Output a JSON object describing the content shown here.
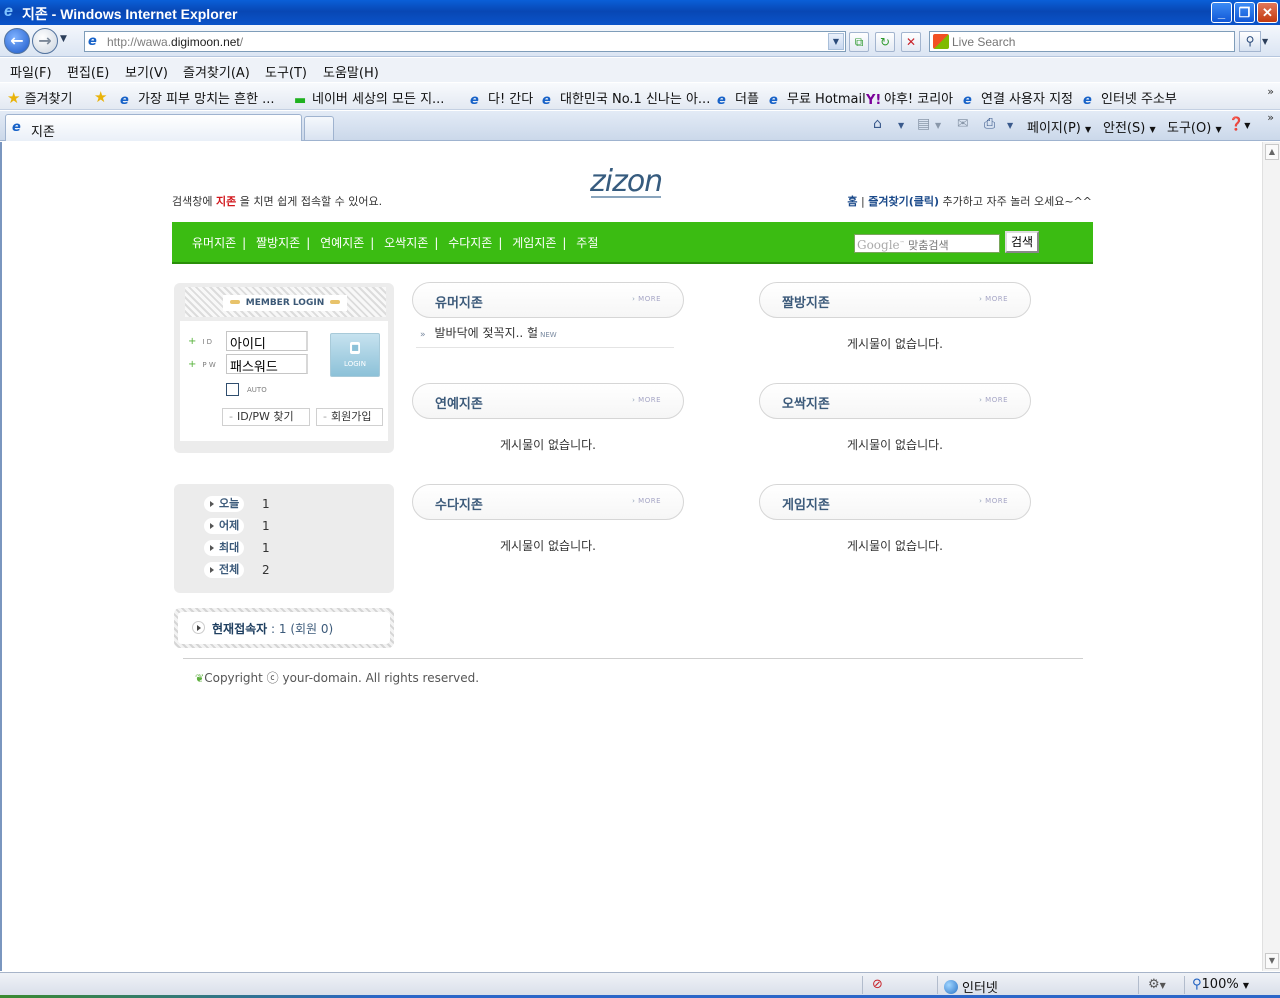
{
  "window": {
    "title": "지존 - Windows Internet Explorer"
  },
  "address": {
    "url_prefix": "http://wawa.",
    "url_domain": "digimoon.net",
    "url_suffix": "/"
  },
  "search": {
    "placeholder": "Live Search"
  },
  "menu": {
    "items": [
      "파일(F)",
      "편집(E)",
      "보기(V)",
      "즐겨찾기(A)",
      "도구(T)",
      "도움말(H)"
    ]
  },
  "favorites": {
    "label": "즐겨찾기",
    "links": [
      "가장 피부 망치는 흔한 ...",
      "네이버 세상의 모든 지...",
      "다! 간다",
      "대한민국 No.1 신나는 아...",
      "더플",
      "무료 Hotmail",
      "야후! 코리아",
      "연결 사용자 지정",
      "인터넷 주소부"
    ]
  },
  "tabs": [
    {
      "label": "지존"
    }
  ],
  "commandbar": {
    "page": "페이지(P)",
    "safety": "안전(S)",
    "tools": "도구(O)"
  },
  "site": {
    "logo": "zizon",
    "tagline_pre": "검색창에 ",
    "tagline_red": "지존",
    "tagline_post": " 을 치면 쉽게 접속할 수 있어요.",
    "toplinks_home": "홈",
    "toplinks_sep": " | ",
    "toplinks_fav": "즐겨찾기(클릭)",
    "toplinks_post": " 추가하고 자주 놀러 오세요~^^",
    "nav": [
      "유머지존",
      "짤방지존",
      "연예지존",
      "오싹지존",
      "수다지존",
      "게임지존",
      "주절"
    ],
    "google_logo": "Google",
    "google_placeholder": "맞춤검색",
    "search_button": "검색"
  },
  "login": {
    "header": "MEMBER LOGIN",
    "id_label": "I D",
    "pw_label": "P W",
    "id_value": "아이디",
    "pw_value": "패스워드",
    "login_button": "LOGIN",
    "auto_label": "AUTO",
    "find_button": "ID/PW 찾기",
    "join_button": "회원가입"
  },
  "stats": [
    {
      "label": "오늘",
      "value": "1"
    },
    {
      "label": "어제",
      "value": "1"
    },
    {
      "label": "최대",
      "value": "1"
    },
    {
      "label": "전체",
      "value": "2"
    }
  ],
  "online": {
    "label": "현재접속자",
    "value": " : 1 (회원 0)"
  },
  "boards": {
    "more": "MORE",
    "empty": "게시물이 없습니다.",
    "humor": {
      "title": "유머지존",
      "post": "발바닥에 젖꼭지.. 헐",
      "post_badge": "NEW"
    },
    "jjalbang": {
      "title": "짤방지존"
    },
    "entertain": {
      "title": "연예지존"
    },
    "scary": {
      "title": "오싹지존"
    },
    "chat": {
      "title": "수다지존"
    },
    "game": {
      "title": "게임지존"
    }
  },
  "footer": {
    "copyright": "Copyright ⓒ your-domain. All rights reserved."
  },
  "statusbar": {
    "zone": "인터넷",
    "zoom": "100%"
  }
}
